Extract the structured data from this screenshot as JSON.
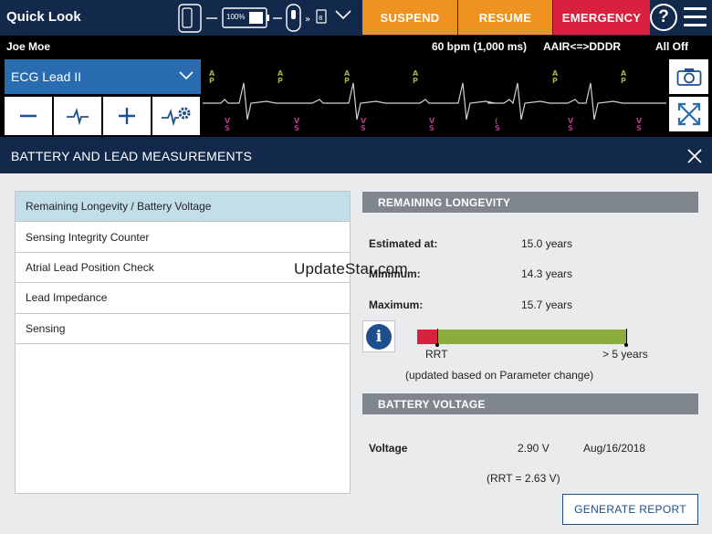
{
  "header": {
    "title": "Quick Look",
    "battery_label": "100%",
    "buttons": {
      "suspend": "SUSPEND",
      "resume": "RESUME",
      "emergency": "EMERGENCY"
    },
    "help_label": "?"
  },
  "ecg": {
    "patient_name": "Joe Moe",
    "rate": "60 bpm (1,000 ms)",
    "mode": "AAIR<=>DDDR",
    "status": "All Off",
    "lead_select": "ECG Lead II"
  },
  "panel": {
    "title": "BATTERY AND LEAD MEASUREMENTS",
    "list": [
      "Remaining Longevity / Battery Voltage",
      "Sensing Integrity Counter",
      "Atrial Lead Position Check",
      "Lead Impedance",
      "Sensing"
    ],
    "selected_index": 0,
    "longevity": {
      "title": "REMAINING LONGEVITY",
      "estimated_label": "Estimated at:",
      "estimated_value": "15.0 years",
      "minimum_label": "Minimum:",
      "minimum_value": "14.3 years",
      "maximum_label": "Maximum:",
      "maximum_value": "15.7 years",
      "bar_start_label": "RRT",
      "bar_end_label": "> 5 years",
      "note": "(updated based on Parameter change)"
    },
    "battery": {
      "title": "BATTERY VOLTAGE",
      "voltage_label": "Voltage",
      "voltage_value": "2.90 V",
      "date": "Aug/16/2018",
      "rrt_note": "(RRT = 2.63 V)"
    },
    "generate_button": "GENERATE REPORT"
  },
  "watermark": "UpdateStar.com",
  "colors": {
    "navy": "#13294b",
    "orange": "#f0921f",
    "emergency_red": "#d8203f",
    "lead_blue": "#2a6cb0",
    "selected_row": "#c2dfe9",
    "section_gray": "#7f868d",
    "bar_green": "#8bad3b",
    "marker_a": "#9ab33a",
    "marker_v": "#b4388c"
  },
  "icons": {
    "minus": "minus-icon",
    "pulse": "pulse-icon",
    "plus": "plus-icon",
    "pulse_settings": "pulse-settings-icon",
    "camera": "camera-icon",
    "expand": "expand-icon",
    "close": "close-icon",
    "info": "info-icon"
  }
}
